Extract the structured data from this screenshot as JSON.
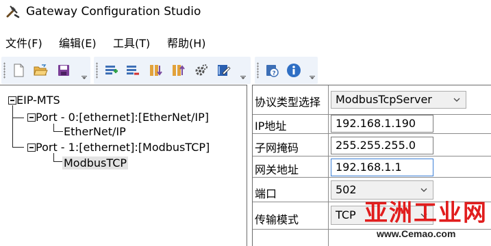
{
  "window": {
    "title": "Gateway Configuration Studio",
    "icon": "tools-icon"
  },
  "menu": [
    {
      "label": "文件(F)"
    },
    {
      "label": "编辑(E)"
    },
    {
      "label": "工具(T)"
    },
    {
      "label": "帮助(H)"
    }
  ],
  "toolbar": {
    "groups": [
      [
        "new-file-icon",
        "open-folder-icon",
        "save-icon"
      ],
      [
        "add-port-icon",
        "remove-port-icon",
        "download-config-icon",
        "upload-config-icon",
        "settings-gear-icon",
        "edit-notebook-icon"
      ],
      [
        "help-icon",
        "info-icon"
      ]
    ]
  },
  "tree": {
    "root": "EIP-MTS",
    "port0": "Port - 0:[ethernet]:[EtherNet/IP]",
    "port0_child": "EtherNet/IP",
    "port1": "Port - 1:[ethernet]:[ModbusTCP]",
    "port1_child": "ModbusTCP"
  },
  "properties": {
    "protocol": {
      "label": "协议类型选择",
      "value": "ModbusTcpServer"
    },
    "ip": {
      "label": "IP地址",
      "value": "192.168.1.190"
    },
    "mask": {
      "label": "子网掩码",
      "value": "255.255.255.0"
    },
    "gateway": {
      "label": "网关地址",
      "value": "192.168.1.1"
    },
    "port": {
      "label": "端口",
      "value": "502"
    },
    "mode": {
      "label": "传输模式",
      "value": "TCP"
    }
  },
  "watermark": {
    "main": "亚洲工业网",
    "url": "www.Cemao.com"
  },
  "colors": {
    "accent_focus": "#3c7fd6",
    "watermark": "#e11d1d",
    "toolbar_bg": "#eef3fa"
  }
}
